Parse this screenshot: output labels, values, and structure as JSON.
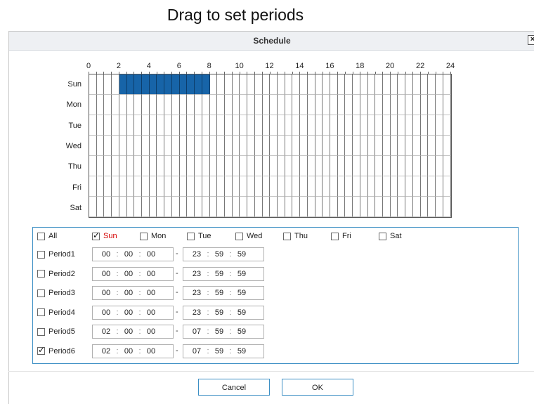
{
  "heading": "Drag to set periods",
  "dialog": {
    "title": "Schedule",
    "close_label": "×"
  },
  "hours": [
    "0",
    "2",
    "4",
    "6",
    "8",
    "10",
    "12",
    "14",
    "16",
    "18",
    "20",
    "22",
    "24"
  ],
  "days": [
    "Sun",
    "Mon",
    "Tue",
    "Wed",
    "Thu",
    "Fri",
    "Sat"
  ],
  "selected_ranges": {
    "Sun": [
      [
        2,
        8
      ]
    ]
  },
  "colors": {
    "selected_cell": "#1764a8",
    "panel_border": "#3c8fc4",
    "active_day": "#d40000"
  },
  "day_checks": [
    {
      "label": "All",
      "checked": false,
      "active": false
    },
    {
      "label": "Sun",
      "checked": true,
      "active": true
    },
    {
      "label": "Mon",
      "checked": false,
      "active": false
    },
    {
      "label": "Tue",
      "checked": false,
      "active": false
    },
    {
      "label": "Wed",
      "checked": false,
      "active": false
    },
    {
      "label": "Thu",
      "checked": false,
      "active": false
    },
    {
      "label": "Fri",
      "checked": false,
      "active": false
    },
    {
      "label": "Sat",
      "checked": false,
      "active": false
    }
  ],
  "periods": [
    {
      "label": "Period1",
      "checked": false,
      "start": [
        "00",
        "00",
        "00"
      ],
      "end": [
        "23",
        "59",
        "59"
      ]
    },
    {
      "label": "Period2",
      "checked": false,
      "start": [
        "00",
        "00",
        "00"
      ],
      "end": [
        "23",
        "59",
        "59"
      ]
    },
    {
      "label": "Period3",
      "checked": false,
      "start": [
        "00",
        "00",
        "00"
      ],
      "end": [
        "23",
        "59",
        "59"
      ]
    },
    {
      "label": "Period4",
      "checked": false,
      "start": [
        "00",
        "00",
        "00"
      ],
      "end": [
        "23",
        "59",
        "59"
      ]
    },
    {
      "label": "Period5",
      "checked": false,
      "start": [
        "02",
        "00",
        "00"
      ],
      "end": [
        "07",
        "59",
        "59"
      ]
    },
    {
      "label": "Period6",
      "checked": true,
      "start": [
        "02",
        "00",
        "00"
      ],
      "end": [
        "07",
        "59",
        "59"
      ]
    }
  ],
  "time_separator": ":",
  "range_separator": "-",
  "buttons": {
    "cancel": "Cancel",
    "ok": "OK"
  }
}
